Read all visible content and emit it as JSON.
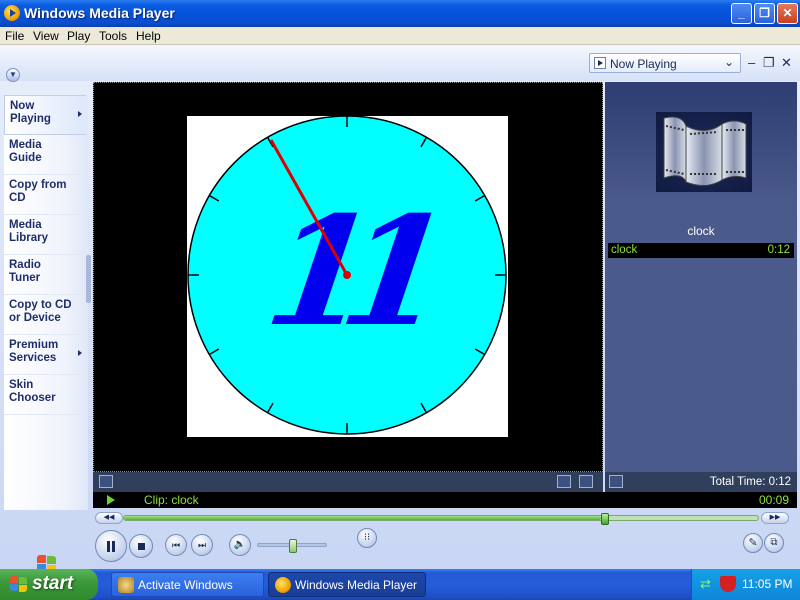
{
  "window": {
    "title": "Windows Media Player"
  },
  "menu": [
    "File",
    "View",
    "Play",
    "Tools",
    "Help"
  ],
  "now_playing_dropdown": {
    "label": "Now Playing",
    "chevron": "⌄"
  },
  "sidebar": {
    "items": [
      {
        "label": "Now\nPlaying",
        "has_arrow": true,
        "active": true
      },
      {
        "label": "Media\nGuide",
        "has_arrow": false
      },
      {
        "label": "Copy from\nCD",
        "has_arrow": false
      },
      {
        "label": "Media\nLibrary",
        "has_arrow": false
      },
      {
        "label": "Radio\nTuner",
        "has_arrow": false
      },
      {
        "label": "Copy to CD\nor Device",
        "has_arrow": false
      },
      {
        "label": "Premium\nServices",
        "has_arrow": true
      },
      {
        "label": "Skin\nChooser",
        "has_arrow": false
      }
    ]
  },
  "video": {
    "clock": {
      "face_color": "#00ffff",
      "numeral": "11",
      "numeral_color": "#0000ee",
      "hand_color": "#dd0000"
    }
  },
  "right_panel": {
    "album_caption": "clock",
    "playlist": [
      {
        "name": "clock",
        "duration": "0:12"
      }
    ],
    "total_time": "Total Time: 0:12"
  },
  "status_bar": {
    "clip": "Clip: clock",
    "elapsed": "00:09"
  },
  "seek": {
    "progress": 0.75
  },
  "volume": {
    "level": 0.5
  },
  "taskbar": {
    "start_label": "start",
    "tasks": [
      {
        "label": "Activate Windows"
      },
      {
        "label": "Windows Media Player"
      }
    ],
    "clock": "11:05 PM"
  },
  "colors": {
    "title_bar": "#0551d8",
    "status_text": "#8ee040",
    "taskbar": "#245ddb",
    "start_button": "#3c9a3a"
  }
}
